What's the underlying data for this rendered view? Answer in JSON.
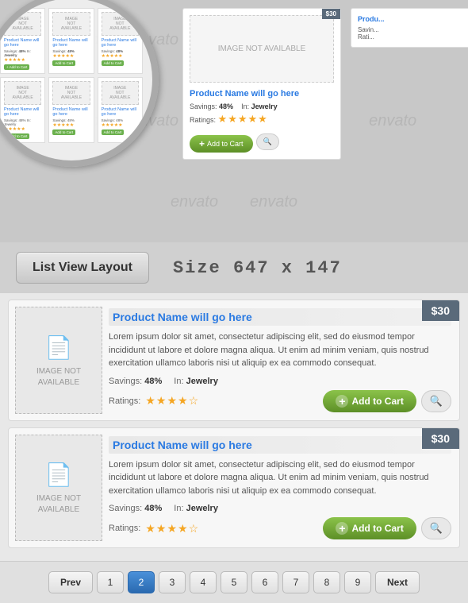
{
  "top_section": {
    "image_not_available": "IMAGE NOT AVAILABLE",
    "watermark_text": "envato"
  },
  "large_preview": {
    "title": "Product Name will go here",
    "savings_label": "Savings:",
    "savings_val": "48%",
    "in_label": "In:",
    "category": "Jewelry",
    "ratings_label": "Ratings:",
    "price": "$30",
    "add_to_cart": "Add to Cart"
  },
  "label_section": {
    "layout_label": "List View Layout",
    "size_label": "Size 647 x 147"
  },
  "list_items": [
    {
      "image_label": "IMAGE NOT\nAVAILABLE",
      "title": "Product Name will go here",
      "description": "Lorem ipsum dolor sit amet, consectetur adipiscing elit, sed do eiusmod tempor incididunt ut labore et dolore magna aliqua. Ut enim ad minim veniam, quis nostrud exercitation ullamco laboris nisi ut aliquip ex ea commodo consequat.",
      "savings_label": "Savings:",
      "savings_val": "48%",
      "in_label": "In:",
      "category": "Jewelry",
      "ratings_label": "Ratings:",
      "price": "$30",
      "add_to_cart": "Add to Cart",
      "stars": "★★★★☆"
    },
    {
      "image_label": "IMAGE NOT\nAVAILABLE",
      "title": "Product Name will go here",
      "description": "Lorem ipsum dolor sit amet, consectetur adipiscing elit, sed do eiusmod tempor incididunt ut labore et dolore magna aliqua. Ut enim ad minim veniam, quis nostrud exercitation ullamco laboris nisi ut aliquip ex ea commodo consequat.",
      "savings_label": "Savings:",
      "savings_val": "48%",
      "in_label": "In:",
      "category": "Jewelry",
      "ratings_label": "Ratings:",
      "price": "$30",
      "add_to_cart": "Add to Cart",
      "stars": "★★★★☆"
    }
  ],
  "pagination": {
    "prev_label": "Prev",
    "next_label": "Next",
    "pages": [
      "1",
      "2",
      "3",
      "4",
      "5",
      "6",
      "7",
      "8",
      "9"
    ],
    "active_page": "2"
  }
}
